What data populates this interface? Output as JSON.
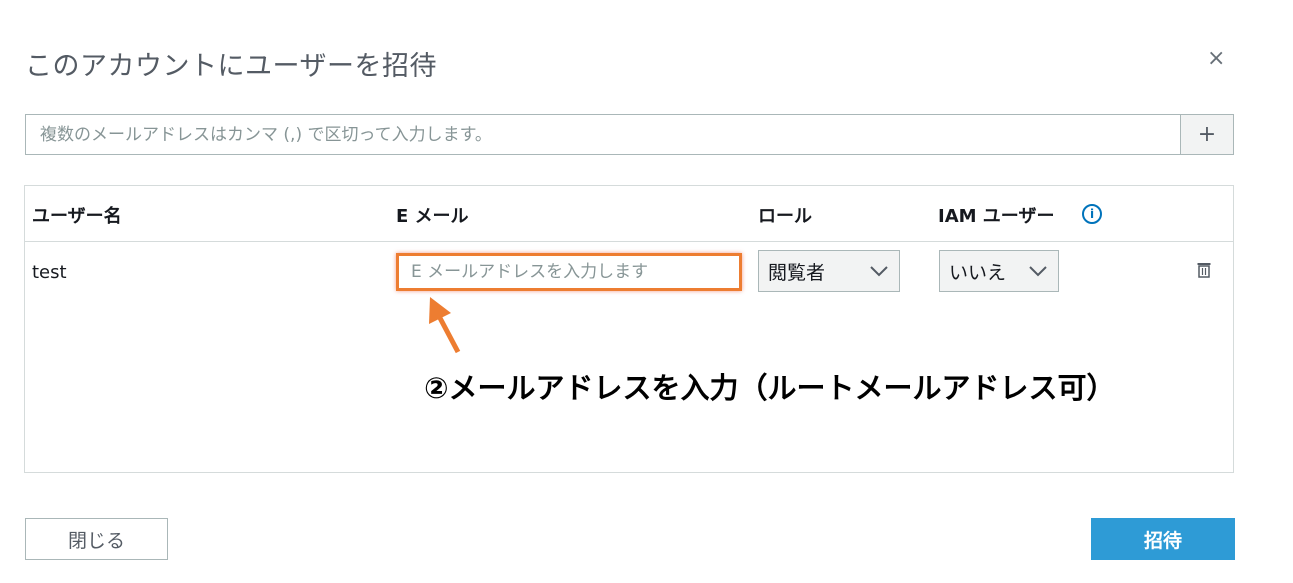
{
  "dialog": {
    "title": "このアカウントにユーザーを招待",
    "close_glyph": "×"
  },
  "email_entry": {
    "placeholder": "複数のメールアドレスはカンマ (,) で区切って入力します。",
    "value": "",
    "add_glyph": "+"
  },
  "table": {
    "headers": {
      "username": "ユーザー名",
      "email": "E メール",
      "role": "ロール",
      "iam_user": "IAM ユーザー",
      "info_glyph": "i"
    },
    "rows": [
      {
        "username": "test",
        "email_placeholder": "E メールアドレスを入力します",
        "email_value": "",
        "role": "閲覧者",
        "iam_user": "いいえ"
      }
    ]
  },
  "annotation": {
    "text": "②メールアドレスを入力（ルートメールアドレス可）",
    "color": "#ed7d31"
  },
  "footer": {
    "close_label": "閉じる",
    "invite_label": "招待"
  },
  "colors": {
    "primary": "#2e9bd6",
    "info": "#0073bb",
    "highlight": "#ed7d31"
  }
}
